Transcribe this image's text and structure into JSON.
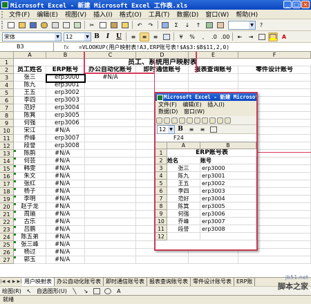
{
  "window": {
    "title": "Microsoft Excel - 新建 Microsoft Excel 工作表.xls",
    "buttons": {
      "minimize": "_",
      "maximize": "□",
      "close": "×"
    }
  },
  "menu": {
    "items": [
      "文件(F)",
      "编辑(E)",
      "视图(V)",
      "插入(I)",
      "格式(O)",
      "工具(T)",
      "数据(D)",
      "窗口(W)",
      "帮助(H)"
    ],
    "help_box": "键入需要帮助的问题"
  },
  "format_bar": {
    "font_name": "宋体",
    "font_size": "12",
    "bold": "B",
    "italic": "I",
    "underline": "U"
  },
  "formula_bar": {
    "name_box": "B3",
    "fx": "fx",
    "formula": "=VLOOKUP(用户映射表!A3,ERP账号表!$A$3:$B$11,2,0)"
  },
  "sheet": {
    "columns": [
      "A",
      "B",
      "C",
      "D",
      "E",
      "F"
    ],
    "title": "员工、系统用户映射表",
    "headers": [
      "员工姓名",
      "ERP账号",
      "办公自动化账号",
      "即时通信账号",
      "报表查询账号",
      "零件设计账号"
    ],
    "rows": [
      {
        "num": "3",
        "name": "张三",
        "erp": "erp3000",
        "c": "#N/A"
      },
      {
        "num": "4",
        "name": "陈九",
        "erp": "erp3001",
        "c": ""
      },
      {
        "num": "5",
        "name": "王五",
        "erp": "erp3002",
        "c": ""
      },
      {
        "num": "6",
        "name": "李四",
        "erp": "erp3003",
        "c": ""
      },
      {
        "num": "7",
        "name": "范好",
        "erp": "erp3004",
        "c": ""
      },
      {
        "num": "8",
        "name": "陈箕",
        "erp": "erp3005",
        "c": ""
      },
      {
        "num": "9",
        "name": "何强",
        "erp": "erp3006",
        "c": ""
      },
      {
        "num": "10",
        "name": "宋江",
        "erp": "#N/A",
        "c": ""
      },
      {
        "num": "11",
        "name": "乔峰",
        "erp": "erp3007",
        "c": ""
      },
      {
        "num": "12",
        "name": "段誉",
        "erp": "erp3008",
        "c": ""
      },
      {
        "num": "13",
        "name": "陈鹃",
        "erp": "#N/A",
        "c": ""
      },
      {
        "num": "14",
        "name": "何芸",
        "erp": "#N/A",
        "c": ""
      },
      {
        "num": "15",
        "name": "韩雯",
        "erp": "#N/A",
        "c": ""
      },
      {
        "num": "16",
        "name": "朱文",
        "erp": "#N/A",
        "c": ""
      },
      {
        "num": "17",
        "name": "张红",
        "erp": "#N/A",
        "c": ""
      },
      {
        "num": "18",
        "name": "杨子",
        "erp": "#N/A",
        "c": ""
      },
      {
        "num": "19",
        "name": "李明",
        "erp": "#N/A",
        "c": ""
      },
      {
        "num": "20",
        "name": "赵子龙",
        "erp": "#N/A",
        "c": ""
      },
      {
        "num": "21",
        "name": "周瑜",
        "erp": "#N/A",
        "c": ""
      },
      {
        "num": "22",
        "name": "古乐",
        "erp": "#N/A",
        "c": ""
      },
      {
        "num": "23",
        "name": "吕鹏",
        "erp": "#N/A",
        "c": ""
      },
      {
        "num": "24",
        "name": "陈五弟",
        "erp": "#N/A",
        "c": ""
      },
      {
        "num": "25",
        "name": "张三峰",
        "erp": "#N/A",
        "c": ""
      },
      {
        "num": "26",
        "name": "杨过",
        "erp": "#N/A",
        "c": ""
      },
      {
        "num": "27",
        "name": "郭玉",
        "erp": "#N/A",
        "c": ""
      }
    ]
  },
  "overlay_window": {
    "title": "Microsoft Excel - 新建 Microsoft",
    "menu1": [
      "文件(F)",
      "编辑(E)",
      "插入(I)"
    ],
    "menu2": [
      "数据(D)",
      "窗口(W)"
    ],
    "font_size": "12",
    "name_box": "F24",
    "columns": [
      "A",
      "B"
    ],
    "title_cell": "ERP账号表",
    "headers": [
      "姓名",
      "账号"
    ],
    "rows": [
      {
        "num": "3",
        "name": "张三",
        "acct": "erp3000"
      },
      {
        "num": "4",
        "name": "陈九",
        "acct": "erp3001"
      },
      {
        "num": "5",
        "name": "王五",
        "acct": "erp3002"
      },
      {
        "num": "6",
        "name": "李四",
        "acct": "erp3003"
      },
      {
        "num": "7",
        "name": "范好",
        "acct": "erp3004"
      },
      {
        "num": "8",
        "name": "陈箕",
        "acct": "erp3005"
      },
      {
        "num": "9",
        "name": "何强",
        "acct": "erp3006"
      },
      {
        "num": "10",
        "name": "乔峰",
        "acct": "erp3007"
      },
      {
        "num": "11",
        "name": "段誉",
        "acct": "erp3008"
      },
      {
        "num": "12",
        "name": "",
        "acct": ""
      }
    ]
  },
  "sheet_tabs": [
    "用户映射表",
    "办公自动化账号表",
    "即时通信账号表",
    "报表查询账号表",
    "零件设计账号表",
    "ERP账"
  ],
  "drawing_bar": {
    "draw": "绘图(R)",
    "autoshape": "自选图形(U)"
  },
  "status": "就绪",
  "watermark": {
    "site": "jb51.net",
    "brand": "脚本之家"
  },
  "colors": {
    "titlebar": "#0b46c2",
    "selection_border": "#000000",
    "annotation": "#d83a5a"
  }
}
